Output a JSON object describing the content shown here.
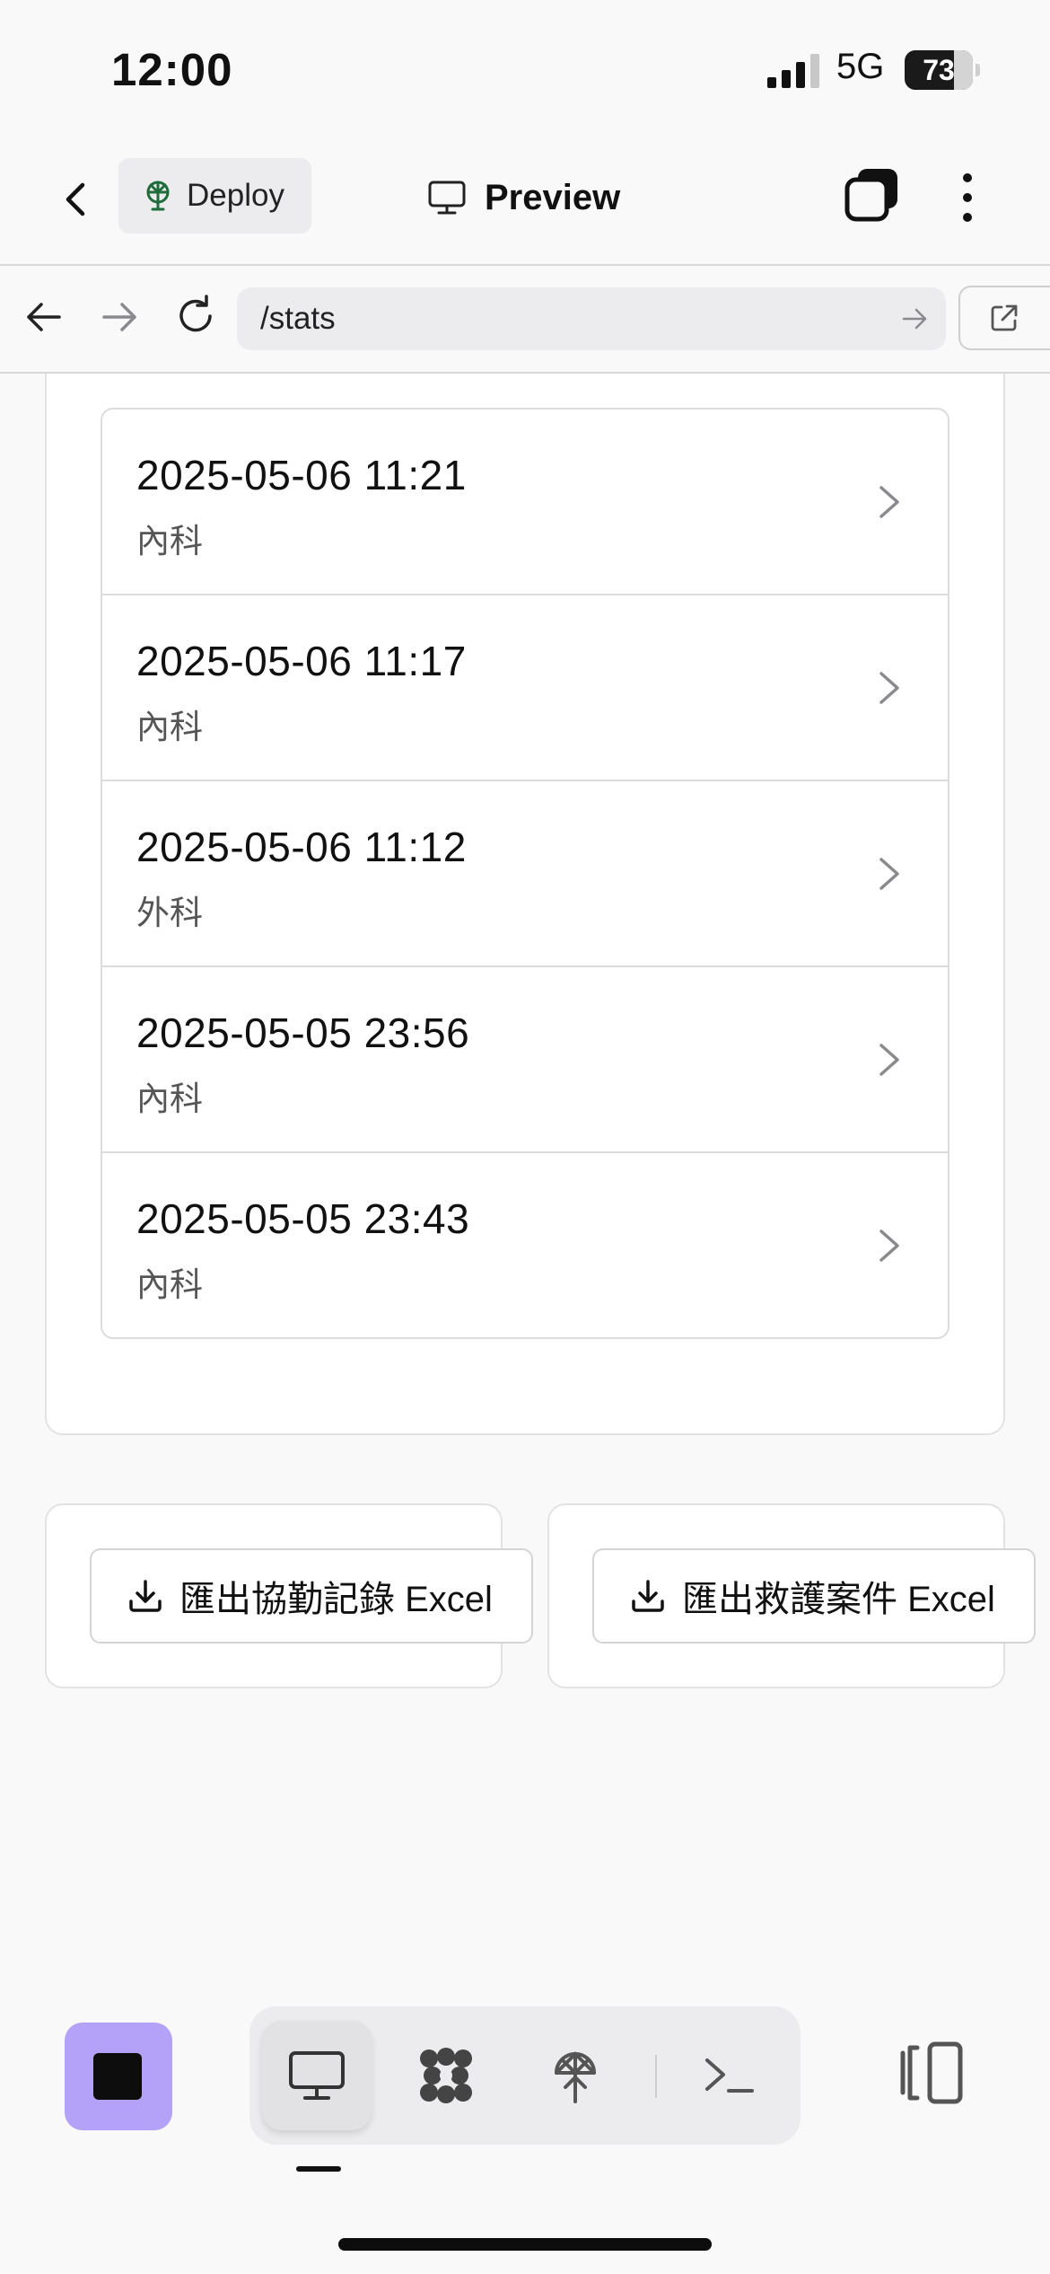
{
  "status_bar": {
    "time": "12:00",
    "network": "5G",
    "battery_percent": "73",
    "battery_level": 0.73
  },
  "header": {
    "deploy_label": "Deploy",
    "title": "Preview"
  },
  "url_bar": {
    "path": "/stats"
  },
  "records": [
    {
      "time": "2025-05-06 11:21",
      "department": "內科"
    },
    {
      "time": "2025-05-06 11:17",
      "department": "內科"
    },
    {
      "time": "2025-05-06 11:12",
      "department": "外科"
    },
    {
      "time": "2025-05-05 23:56",
      "department": "內科"
    },
    {
      "time": "2025-05-05 23:43",
      "department": "內科"
    }
  ],
  "exports": {
    "assist_label": "匯出協勤記錄 Excel",
    "rescue_label": "匯出救護案件 Excel"
  },
  "toolbar": {
    "items": [
      "stop",
      "preview",
      "integrations",
      "deploy",
      "terminal"
    ],
    "active": "preview"
  },
  "colors": {
    "accent_purple": "#b3a2f7",
    "deploy_green": "#1f6b3a",
    "background": "#f9f9fa"
  },
  "icons": {
    "back": "chevron-left-icon",
    "deploy": "antenna-icon",
    "preview": "monitor-icon",
    "tabs": "tabs-icon",
    "more": "more-vertical-icon",
    "record_open": "chevron-right-icon",
    "export": "download-icon"
  }
}
